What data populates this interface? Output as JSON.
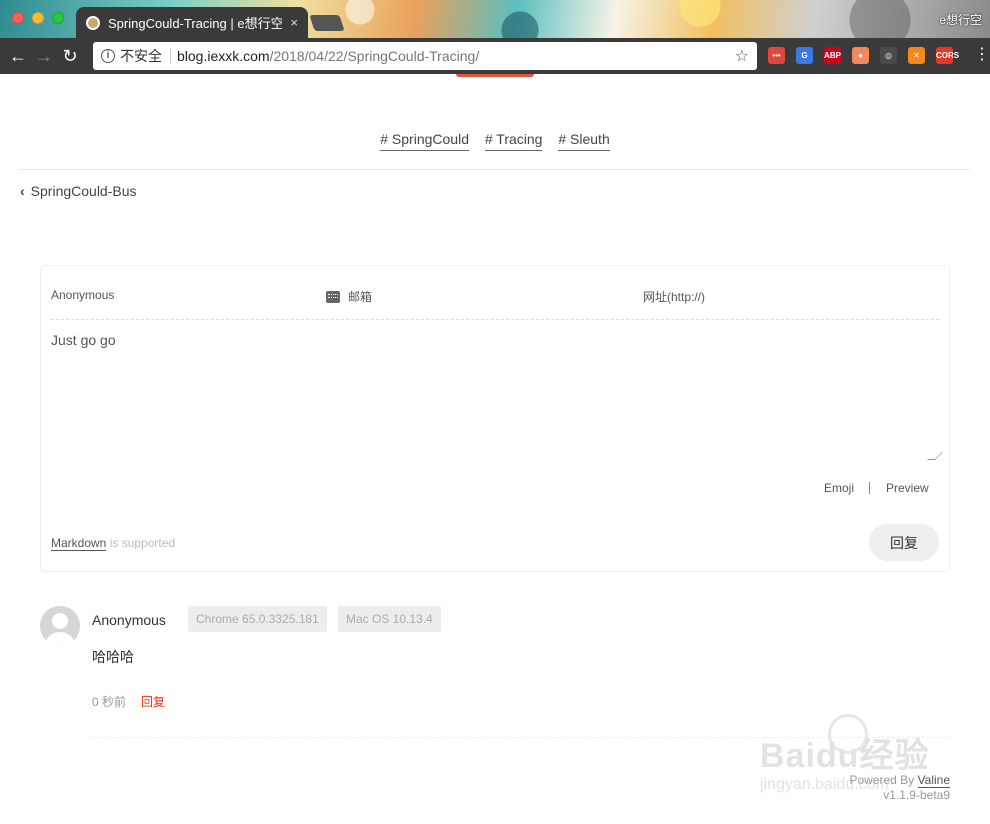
{
  "browser": {
    "tab_title": "SpringCould-Tracing | e想行空",
    "tab_close": "×",
    "profile_label": "e想行空",
    "security_label": "不安全",
    "url_host": "blog.iexxk.com",
    "url_path": "/2018/04/22/SpringCould-Tracing/",
    "extensions": [
      {
        "name": "ext-1",
        "color": "#e0483e",
        "text": "•••"
      },
      {
        "name": "google-translate",
        "color": "#3b78e7",
        "text": "G"
      },
      {
        "name": "adblock-plus",
        "color": "#d0021b",
        "text": "ABP"
      },
      {
        "name": "ext-4",
        "color": "#f08a5d",
        "text": "●"
      },
      {
        "name": "ext-5",
        "color": "#4a4a4a",
        "text": "◎"
      },
      {
        "name": "ext-6",
        "color": "#f5871f",
        "text": "✕"
      },
      {
        "name": "cors",
        "color": "#e5382a",
        "text": "CORS"
      }
    ]
  },
  "post": {
    "tags": [
      "# SpringCould",
      "# Tracing",
      "# Sleuth"
    ],
    "prev_post": "SpringCould-Bus"
  },
  "comment_form": {
    "nick_placeholder": "Anonymous",
    "mail_placeholder": "邮箱",
    "link_placeholder": "网址(http://)",
    "textarea_value": "Just go go",
    "emoji_label": "Emoji",
    "preview_label": "Preview",
    "markdown_label": "Markdown",
    "markdown_hint": " is supported",
    "submit_label": "回复"
  },
  "comments": [
    {
      "nick": "Anonymous",
      "browser": "Chrome 65.0.3325.181",
      "os": "Mac OS 10.13.4",
      "body": "哈哈哈",
      "time": "0 秒前",
      "reply_label": "回复"
    }
  ],
  "footer": {
    "powered_by": "Powered By ",
    "valine_label": "Valine",
    "version": "v1.1.9-beta9"
  },
  "watermark": {
    "text": "Baidu经验",
    "sub": "jingyan.baidu.com"
  }
}
